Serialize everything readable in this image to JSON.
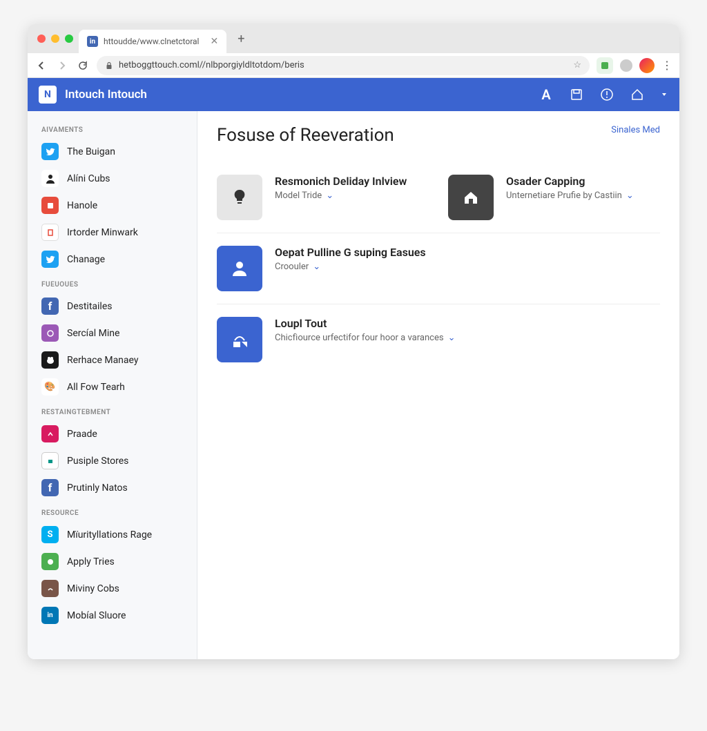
{
  "browser": {
    "tab_title": "httoudde/www.clnetctoral",
    "url": "hetboggttouch.coml//nlbporgiyldltotdom/beris"
  },
  "app": {
    "title": "Intouch Intouch",
    "logo_letter": "N"
  },
  "sidebar": {
    "sections": [
      {
        "title": "AIVAMENTS",
        "items": [
          {
            "label": "The Buigan"
          },
          {
            "label": "Alíni Cubs"
          },
          {
            "label": "Hanole"
          },
          {
            "label": "Irtorder Minwark"
          },
          {
            "label": "Chanage"
          }
        ]
      },
      {
        "title": "FUEUOUES",
        "items": [
          {
            "label": "Destitailes"
          },
          {
            "label": "Sercíal Mine"
          },
          {
            "label": "Rerhace Manaey"
          },
          {
            "label": "All Fow Tearh"
          }
        ]
      },
      {
        "title": "RESTAINGTEBMENT",
        "items": [
          {
            "label": "Praade"
          },
          {
            "label": "Pusiple Stores"
          },
          {
            "label": "Prutinly Natos"
          }
        ]
      },
      {
        "title": "RESOURCE",
        "items": [
          {
            "label": "Mïurityllations Rage"
          },
          {
            "label": "Apply Tries"
          },
          {
            "label": "Miviny Cobs"
          },
          {
            "label": "Mobíal Sluore"
          }
        ]
      }
    ]
  },
  "main": {
    "title": "Fosuse of Reeveration",
    "header_link": "Sinales Med",
    "cards": [
      {
        "title": "Resmonich Deliday Inlview",
        "sub": "Model Tride"
      },
      {
        "title": "Osader Capping",
        "sub": "Unternetiare Prufie by Castiin"
      },
      {
        "title": "Oepat Pulline G suping Easues",
        "sub": "Croouler"
      },
      {
        "title": "Loupl Tout",
        "sub": "Chicfìource urfectifor four hoor a varances"
      }
    ]
  }
}
